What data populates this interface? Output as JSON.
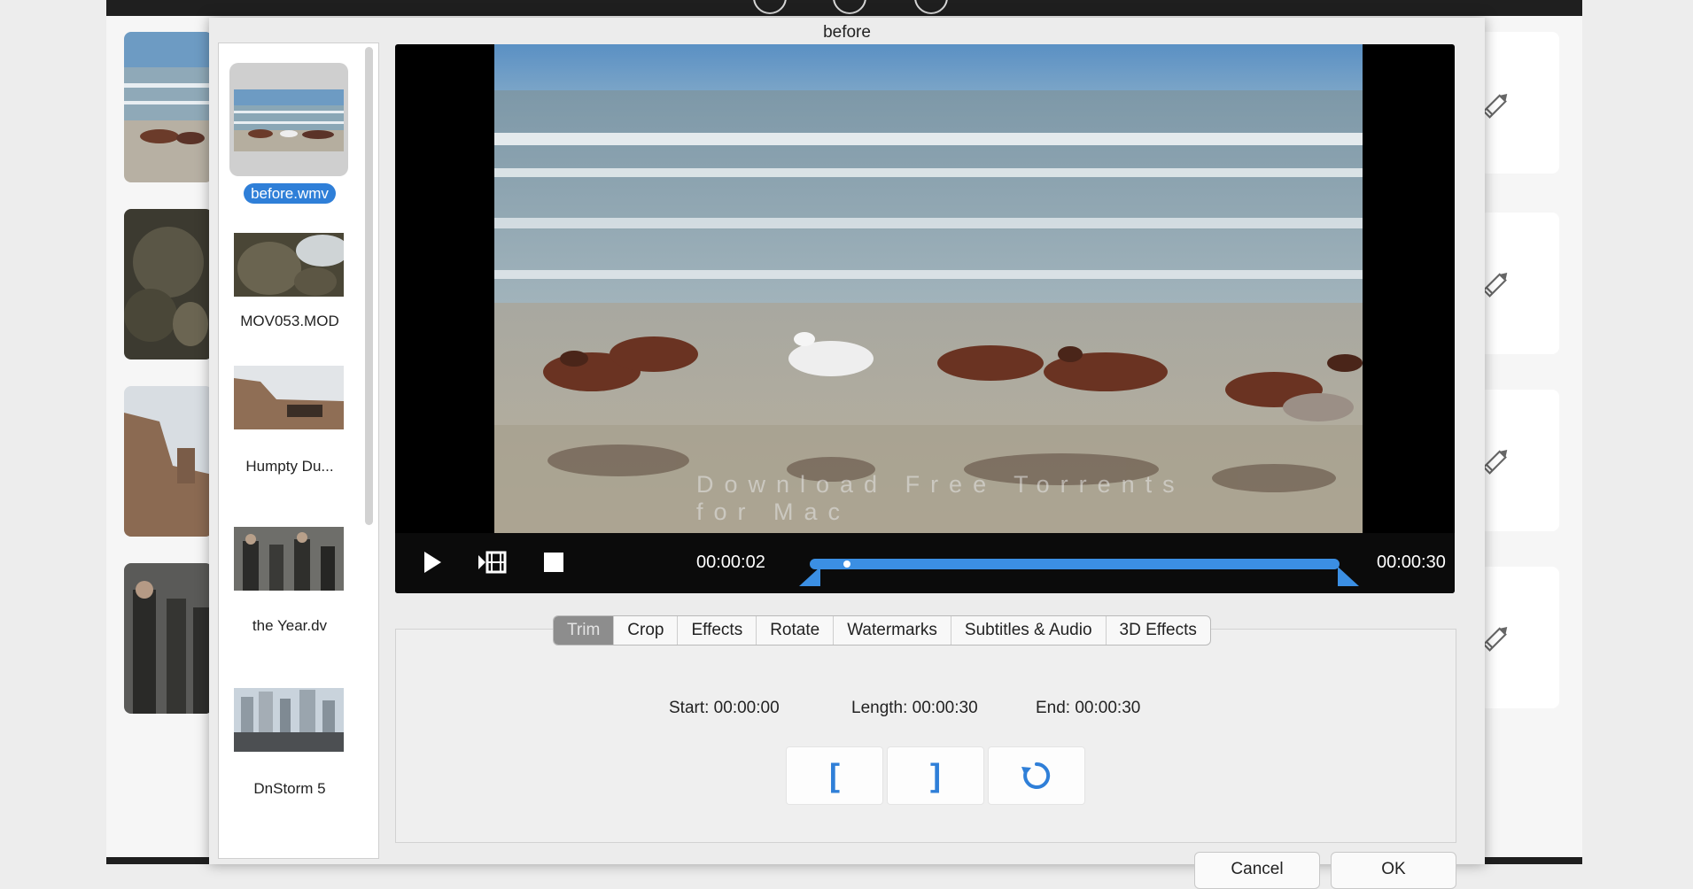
{
  "dialog": {
    "title": "before"
  },
  "file_list": {
    "items": [
      {
        "label": "before.wmv",
        "selected": true
      },
      {
        "label": "MOV053.MOD",
        "selected": false
      },
      {
        "label": "Humpty Du...",
        "selected": false
      },
      {
        "label": "the Year.dv",
        "selected": false
      },
      {
        "label": "DnStorm 5",
        "selected": false
      }
    ]
  },
  "player": {
    "current_time": "00:00:02",
    "total_time": "00:00:30",
    "progress": 0.07,
    "buttons": [
      "play-icon",
      "clip-snapshot-icon",
      "stop-icon"
    ],
    "watermark": "Download Free Torrents for Mac"
  },
  "tabs": [
    {
      "label": "Trim",
      "active": true
    },
    {
      "label": "Crop",
      "active": false
    },
    {
      "label": "Effects",
      "active": false
    },
    {
      "label": "Rotate",
      "active": false
    },
    {
      "label": "Watermarks",
      "active": false
    },
    {
      "label": "Subtitles & Audio",
      "active": false
    },
    {
      "label": "3D Effects",
      "active": false
    }
  ],
  "trim": {
    "start": "Start: 00:00:00",
    "length": "Length: 00:00:30",
    "end": "End: 00:00:30",
    "set_start_label": "[",
    "set_end_label": "]",
    "reset_icon": "reset-icon"
  },
  "footer": {
    "cancel_label": "Cancel",
    "ok_label": "OK"
  },
  "colors": {
    "accent": "#3b8fe3",
    "selection": "#2f7fd8",
    "tab_active": "#8d8d8d"
  }
}
